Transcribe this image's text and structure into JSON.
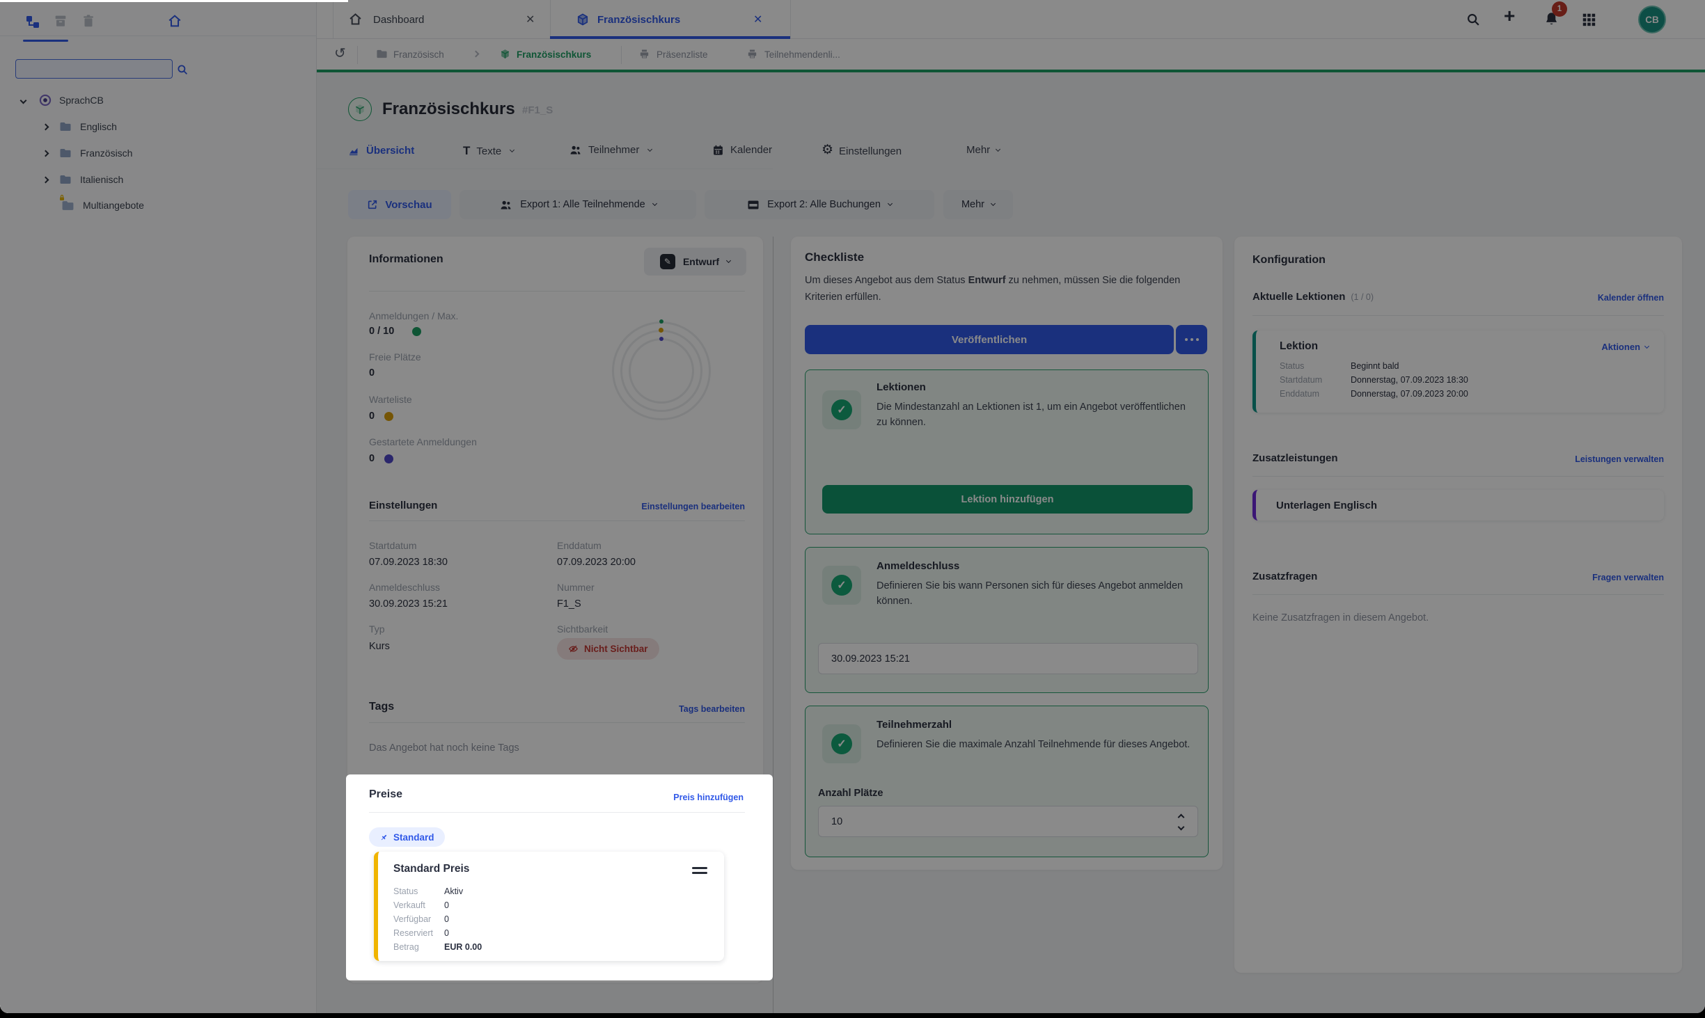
{
  "theme": {
    "primary": "#3159e8",
    "green": "#1d9e63",
    "greenbtn": "#13966a",
    "red": "#c23934",
    "amber": "#d99e0b",
    "yellow": "#f0b400",
    "indigo": "#4f46c8",
    "purple": "#6d28d9",
    "teal": "#0d9488",
    "avatar": "#189182"
  },
  "icon_names": [
    "tree-icon",
    "archive-icon",
    "trash-icon",
    "home-icon",
    "search-icon",
    "chevron-icons",
    "folder-icon",
    "lock-icon",
    "circle-dot-icon",
    "cube-icon",
    "close-icon",
    "undo-icon",
    "printer-icon",
    "plus-icon",
    "bell-icon",
    "grid-icon",
    "chart-icon",
    "text-icon",
    "people-icon",
    "calendar-icon",
    "gear-icon",
    "external-link-icon",
    "card-icon",
    "pencil-icon",
    "eye-off-icon",
    "pin-icon",
    "drag-handle-icon",
    "check-icon",
    "ellipsis-icon"
  ],
  "sidebar": {
    "search_placeholder": "",
    "tree": {
      "root": "SprachCB",
      "children": [
        "Englisch",
        "Französisch",
        "Italienisch"
      ],
      "locked_item": "Multiangebote"
    }
  },
  "topbar": {
    "tabs": [
      {
        "title": "Dashboard"
      },
      {
        "title": "Französischkurs"
      }
    ],
    "close_glyph": "✕",
    "notification_count": "1",
    "avatar_initials": "CB"
  },
  "breadcrumb": {
    "undo_glyph": "↺",
    "items": [
      "Französisch",
      "Französischkurs",
      "Präsenzliste",
      "Teilnehmendenli..."
    ]
  },
  "page": {
    "title": "Französischkurs",
    "code": "#F1_S",
    "tabs": [
      "Übersicht",
      "Texte",
      "Teilnehmer",
      "Kalender",
      "Einstellungen",
      "Mehr"
    ],
    "gear_glyph": "⚙",
    "text_tab_glyph": "T",
    "actions": {
      "preview": "Vorschau",
      "export1": "Export 1: Alle Teilnehmende",
      "export2": "Export 2: Alle Buchungen",
      "more": "Mehr"
    }
  },
  "info": {
    "title": "Informationen",
    "status_button": "Entwurf",
    "pencil_glyph": "✎",
    "stats": [
      {
        "label": "Anmeldungen / Max.",
        "value": "0 / 10"
      },
      {
        "label": "Freie Plätze",
        "value": "0"
      },
      {
        "label": "Warteliste",
        "value": "0"
      },
      {
        "label": "Gestartete Anmeldungen",
        "value": "0"
      }
    ],
    "settings": {
      "title": "Einstellungen",
      "edit_link": "Einstellungen bearbeiten",
      "fields": [
        {
          "label": "Startdatum",
          "value": "07.09.2023 18:30"
        },
        {
          "label": "Enddatum",
          "value": "07.09.2023 20:00"
        },
        {
          "label": "Anmeldeschluss",
          "value": "30.09.2023 15:21"
        },
        {
          "label": "Nummer",
          "value": "F1_S"
        },
        {
          "label": "Typ",
          "value": "Kurs"
        }
      ],
      "visibility_label": "Sichtbarkeit",
      "visibility_badge": "Nicht Sichtbar"
    },
    "tags": {
      "title": "Tags",
      "edit_link": "Tags bearbeiten",
      "empty_text": "Das Angebot hat noch keine Tags"
    }
  },
  "preise": {
    "title": "Preise",
    "add_link": "Preis hinzufügen",
    "pill": "Standard",
    "card": {
      "title": "Standard Preis",
      "rows": [
        {
          "label": "Status",
          "value": "Aktiv"
        },
        {
          "label": "Verkauft",
          "value": "0"
        },
        {
          "label": "Verfügbar",
          "value": "0"
        },
        {
          "label": "Reserviert",
          "value": "0"
        },
        {
          "label": "Betrag",
          "value": "EUR 0.00"
        }
      ]
    }
  },
  "checkliste": {
    "title": "Checkliste",
    "intro_before": "Um dieses Angebot aus dem Status ",
    "intro_bold": "Entwurf",
    "intro_after": " zu nehmen, müssen Sie die folgenden Kriterien erfüllen.",
    "publish_button": "Veröffentlichen",
    "check_glyph": "✓",
    "items": [
      {
        "title": "Lektionen",
        "text": "Die Mindestanzahl an Lektionen ist 1, um ein Angebot veröffentlichen zu können.",
        "button": "Lektion hinzufügen"
      },
      {
        "title": "Anmeldeschluss",
        "text": "Definieren Sie bis wann Personen sich für dieses Angebot anmelden können.",
        "input_value": "30.09.2023 15:21"
      },
      {
        "title": "Teilnehmerzahl",
        "text": "Definieren Sie die maximale Anzahl Teilnehmende für dieses Angebot.",
        "input_label": "Anzahl Plätze",
        "input_value": "10"
      }
    ]
  },
  "konfig": {
    "title": "Konfiguration",
    "lektionen": {
      "title": "Aktuelle Lektionen",
      "count": "(1 / 0)",
      "link": "Kalender öffnen",
      "card": {
        "title": "Lektion",
        "menu": "Aktionen",
        "rows": [
          {
            "label": "Status",
            "value": "Beginnt bald"
          },
          {
            "label": "Startdatum",
            "value": "Donnerstag, 07.09.2023 18:30"
          },
          {
            "label": "Enddatum",
            "value": "Donnerstag, 07.09.2023 20:00"
          }
        ]
      }
    },
    "zusatzleistungen": {
      "title": "Zusatzleistungen",
      "link": "Leistungen verwalten",
      "item": "Unterlagen Englisch"
    },
    "zusatzfragen": {
      "title": "Zusatzfragen",
      "link": "Fragen verwalten",
      "empty_text": "Keine Zusatzfragen in diesem Angebot."
    }
  }
}
